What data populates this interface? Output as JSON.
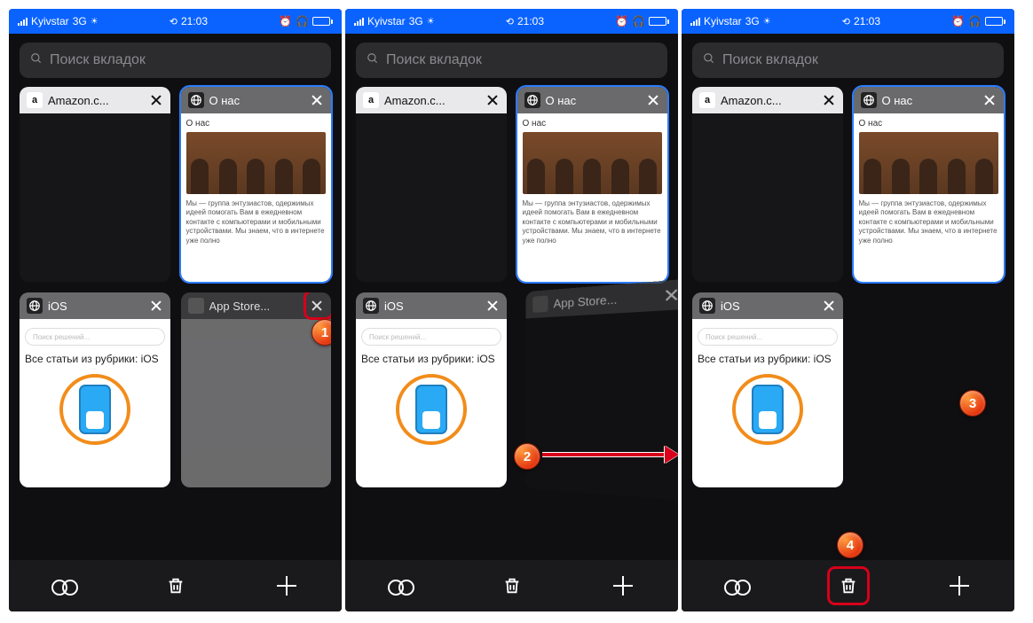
{
  "status": {
    "carrier": "Kyivstar",
    "network": "3G",
    "time": "21:03"
  },
  "search": {
    "placeholder": "Поиск вкладок"
  },
  "tabs": {
    "amazon": {
      "title": "Amazon.c...",
      "favicon_letter": "a"
    },
    "onas": {
      "title": "О нас",
      "body_title": "О нас",
      "body_text": "Мы — группа энтузиастов, одержимых идеей помогать Вам в ежедневном контакте с компьютерами и мобильными устройствами. Мы знаем, что в интернете уже полно"
    },
    "ios": {
      "title": "iOS",
      "pill_placeholder": "Поиск решений...",
      "heading": "Все статьи из рубрики: iOS"
    },
    "appstore": {
      "title": "App Store..."
    }
  },
  "steps": {
    "s1": "1",
    "s2": "2",
    "s3": "3",
    "s4": "4"
  }
}
